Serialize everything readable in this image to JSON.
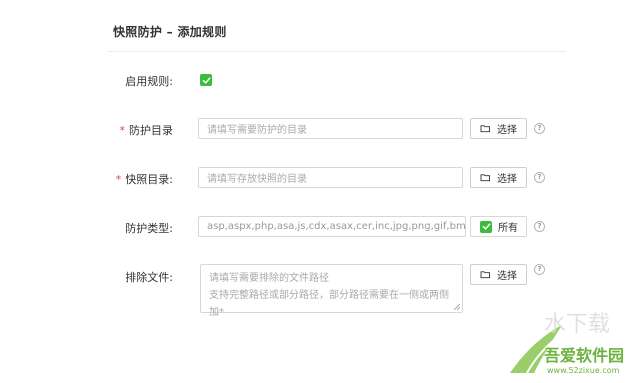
{
  "form": {
    "title": "快照防护 – 添加规则",
    "fields": [
      {
        "label": "启用规则:",
        "required": false,
        "checked": true
      },
      {
        "label": "防护目录",
        "required": true,
        "placeholder": "请填写需要防护的目录",
        "button": "选择"
      },
      {
        "label": "快照目录:",
        "required": true,
        "placeholder": "请填写存放快照的目录",
        "button": "选择"
      },
      {
        "label": "防护类型:",
        "required": false,
        "value": "asp,aspx,php,asa,js,cdx,asax,cer,inc,jpg,png,gif,bmp,jsp",
        "checkbox_label": "所有",
        "checked": true
      },
      {
        "label": "排除文件:",
        "required": false,
        "placeholder_line1": "请填写需要排除的文件路径",
        "placeholder_line2": "支持完整路径或部分路径，部分路径需要在一侧或两侧加*",
        "button": "选择"
      }
    ],
    "required_mark": "*",
    "help_glyph": "?"
  },
  "watermark": {
    "text": "吾爱软件园",
    "url": "www.52zixue.com",
    "accent_color": "#6db33f"
  },
  "colors": {
    "check": "#3dbb3d",
    "required": "#e2423f",
    "border": "#d7d7d7"
  }
}
